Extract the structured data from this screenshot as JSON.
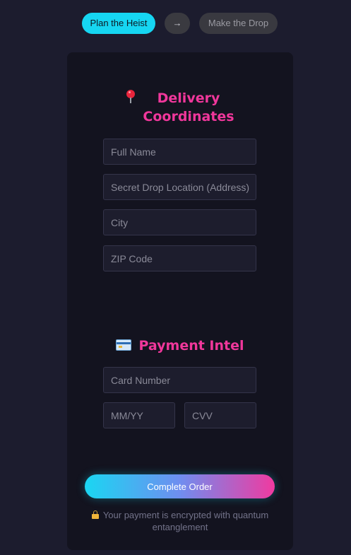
{
  "stepper": {
    "step1_label": "Plan the Heist",
    "arrow": "→",
    "step2_label": "Make the Drop"
  },
  "delivery": {
    "title": "Delivery Coordinates",
    "icon": "pin-icon",
    "full_name_placeholder": "Full Name",
    "address_placeholder": "Secret Drop Location (Address)",
    "city_placeholder": "City",
    "zip_placeholder": "ZIP Code"
  },
  "payment": {
    "title": "Payment Intel",
    "icon": "credit-card-icon",
    "card_number_placeholder": "Card Number",
    "expiry_placeholder": "MM/YY",
    "cvv_placeholder": "CVV"
  },
  "submit": {
    "label": "Complete Order"
  },
  "security_note": {
    "icon": "lock-icon",
    "text": "Your payment is encrypted with quantum entanglement"
  },
  "colors": {
    "accent_cyan": "#16d6f2",
    "accent_pink": "#f0379b",
    "background": "#1c1c2e",
    "card": "#13131f"
  }
}
